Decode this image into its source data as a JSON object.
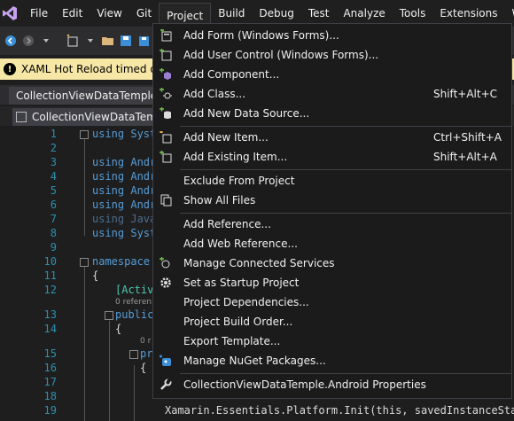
{
  "menubar": {
    "items": [
      "File",
      "Edit",
      "View",
      "Git",
      "Project",
      "Build",
      "Debug",
      "Test",
      "Analyze",
      "Tools",
      "Extensions",
      "Wi"
    ],
    "active": "Project"
  },
  "infobar": {
    "message": "XAML Hot Reload timed out aft"
  },
  "tabs": {
    "document": "CollectionViewDataTemple.An",
    "file": "CollectionViewDataTemple"
  },
  "editor": {
    "lines": [
      {
        "n": "1",
        "text": "using Syst",
        "cls": "kwline"
      },
      {
        "n": "2",
        "text": ""
      },
      {
        "n": "3",
        "text": "using Andr",
        "cls": "kwline"
      },
      {
        "n": "4",
        "text": "using Andr",
        "cls": "kwline"
      },
      {
        "n": "5",
        "text": "using Andr",
        "cls": "kwline"
      },
      {
        "n": "6",
        "text": "using Andr",
        "cls": "kwline"
      },
      {
        "n": "7",
        "text": "using Java",
        "cls": "dimline"
      },
      {
        "n": "8",
        "text": "using Syst",
        "cls": "kwline"
      },
      {
        "n": "9",
        "text": ""
      },
      {
        "n": "10",
        "text": "namespace",
        "cls": "ns"
      },
      {
        "n": "11",
        "text": "{",
        "cls": "brace"
      },
      {
        "n": "12",
        "text": "[Activ",
        "cls": "attrline"
      },
      {
        "n": "13",
        "text": "public",
        "cls": "kwline"
      },
      {
        "n": "14",
        "text": "{",
        "cls": "brace"
      },
      {
        "n": "15",
        "text": "pr",
        "cls": "kwline"
      },
      {
        "n": "16",
        "text": "{",
        "cls": "brace"
      },
      {
        "n": "17",
        "text": ""
      },
      {
        "n": "18",
        "text": ""
      },
      {
        "n": "19",
        "text": "Xamarin.Essentials.Platform.Init(this, savedInstanceStat",
        "cls": "plainline"
      }
    ],
    "ref_hint": "0 referen",
    "ref_hint_short": "0 r"
  },
  "dropdown": {
    "items": [
      {
        "label": "Add Form (Windows Forms)...",
        "shortcut": "",
        "icon": "add-form-icon"
      },
      {
        "label": "Add User Control (Windows Forms)...",
        "shortcut": "",
        "icon": "add-user-control-icon"
      },
      {
        "label": "Add Component...",
        "shortcut": "",
        "icon": "add-component-icon"
      },
      {
        "label": "Add Class...",
        "shortcut": "Shift+Alt+C",
        "icon": "add-class-icon"
      },
      {
        "label": "Add New Data Source...",
        "shortcut": "",
        "icon": "add-data-source-icon"
      },
      {
        "label": "Add New Item...",
        "shortcut": "Ctrl+Shift+A",
        "icon": "add-new-item-icon"
      },
      {
        "label": "Add Existing Item...",
        "shortcut": "Shift+Alt+A",
        "icon": "add-existing-item-icon"
      },
      {
        "label": "Exclude From Project",
        "shortcut": "",
        "icon": ""
      },
      {
        "label": "Show All Files",
        "shortcut": "",
        "icon": "show-all-files-icon"
      },
      {
        "label": "Add Reference...",
        "shortcut": "",
        "icon": ""
      },
      {
        "label": "Add Web Reference...",
        "shortcut": "",
        "icon": ""
      },
      {
        "label": "Manage Connected Services",
        "shortcut": "",
        "icon": "connected-services-icon"
      },
      {
        "label": "Set as Startup Project",
        "shortcut": "",
        "icon": "gear-icon"
      },
      {
        "label": "Project Dependencies...",
        "shortcut": "",
        "icon": ""
      },
      {
        "label": "Project Build Order...",
        "shortcut": "",
        "icon": ""
      },
      {
        "label": "Export Template...",
        "shortcut": "",
        "icon": ""
      },
      {
        "label": "Manage NuGet Packages...",
        "shortcut": "",
        "icon": "nuget-icon"
      },
      {
        "label": "CollectionViewDataTemple.Android Properties",
        "shortcut": "",
        "icon": "wrench-icon"
      }
    ]
  }
}
